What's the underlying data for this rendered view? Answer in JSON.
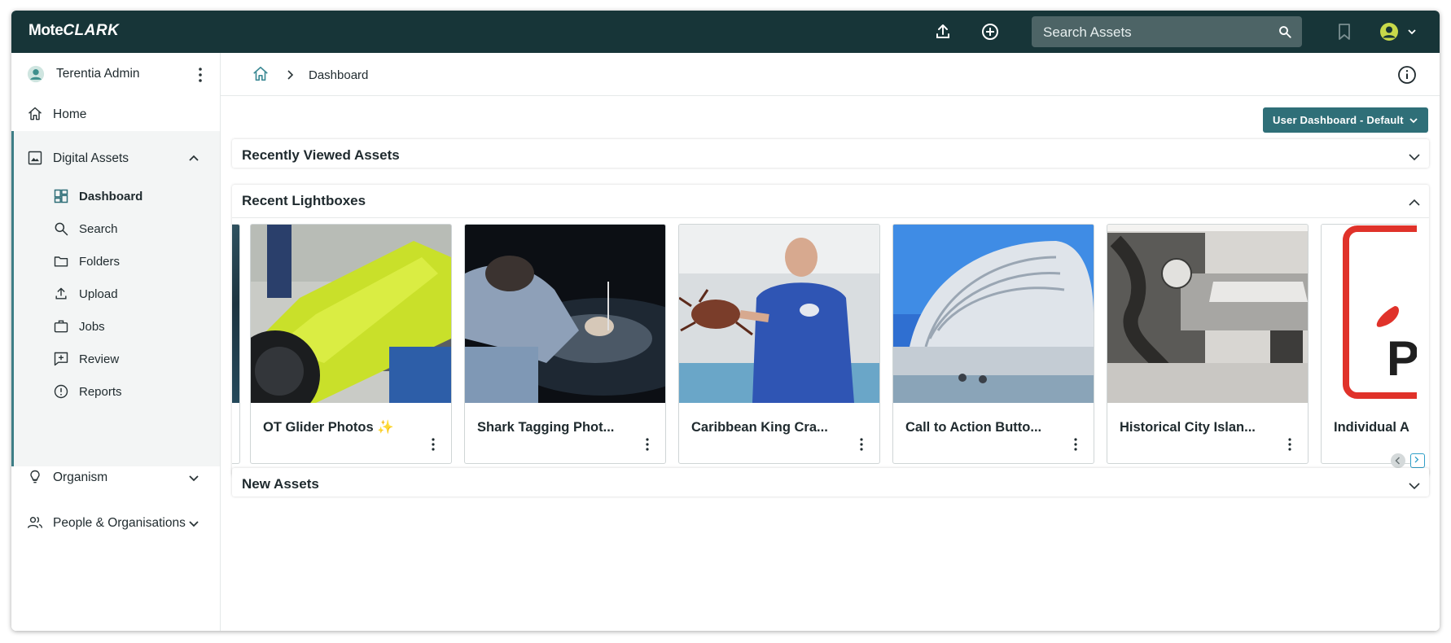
{
  "app": {
    "logo_part1": "Mote",
    "logo_part2": "CLARK",
    "search_placeholder": "Search Assets"
  },
  "topbar_icons": [
    "upload-icon",
    "add-circle-icon",
    "bookmark-icon",
    "user-avatar-icon",
    "chevron-down-icon"
  ],
  "sidebar": {
    "user_name": "Terentia Admin",
    "items": [
      {
        "label": "Home",
        "icon": "home-icon"
      },
      {
        "label": "Digital Assets",
        "icon": "image-icon"
      },
      {
        "label": "Organism",
        "icon": "lightbulb-icon"
      },
      {
        "label": "People & Organisations",
        "icon": "people-icon"
      }
    ],
    "sub_items": [
      {
        "label": "Dashboard",
        "icon": "dashboard-icon"
      },
      {
        "label": "Search",
        "icon": "search-icon"
      },
      {
        "label": "Folders",
        "icon": "folder-icon"
      },
      {
        "label": "Upload",
        "icon": "upload-icon"
      },
      {
        "label": "Jobs",
        "icon": "briefcase-icon"
      },
      {
        "label": "Review",
        "icon": "review-icon"
      },
      {
        "label": "Reports",
        "icon": "info-circle-icon"
      }
    ]
  },
  "breadcrumb": {
    "current": "Dashboard"
  },
  "dashboard_selector": "User Dashboard - Default",
  "panels": {
    "recently_viewed": "Recently Viewed Assets",
    "recent_lightboxes": "Recent Lightboxes",
    "new_assets": "New Assets"
  },
  "lightboxes": [
    {
      "title": "OT Glider Photos",
      "badge": "✨"
    },
    {
      "title": "Shark Tagging Phot..."
    },
    {
      "title": "Caribbean King Cra..."
    },
    {
      "title": "Call to Action Butto..."
    },
    {
      "title": "Historical City Islan..."
    },
    {
      "title": "Individual A"
    }
  ],
  "colors": {
    "topbar": "#173538",
    "accent": "#2f6f78",
    "nav_highlight": "#3d7e86"
  }
}
